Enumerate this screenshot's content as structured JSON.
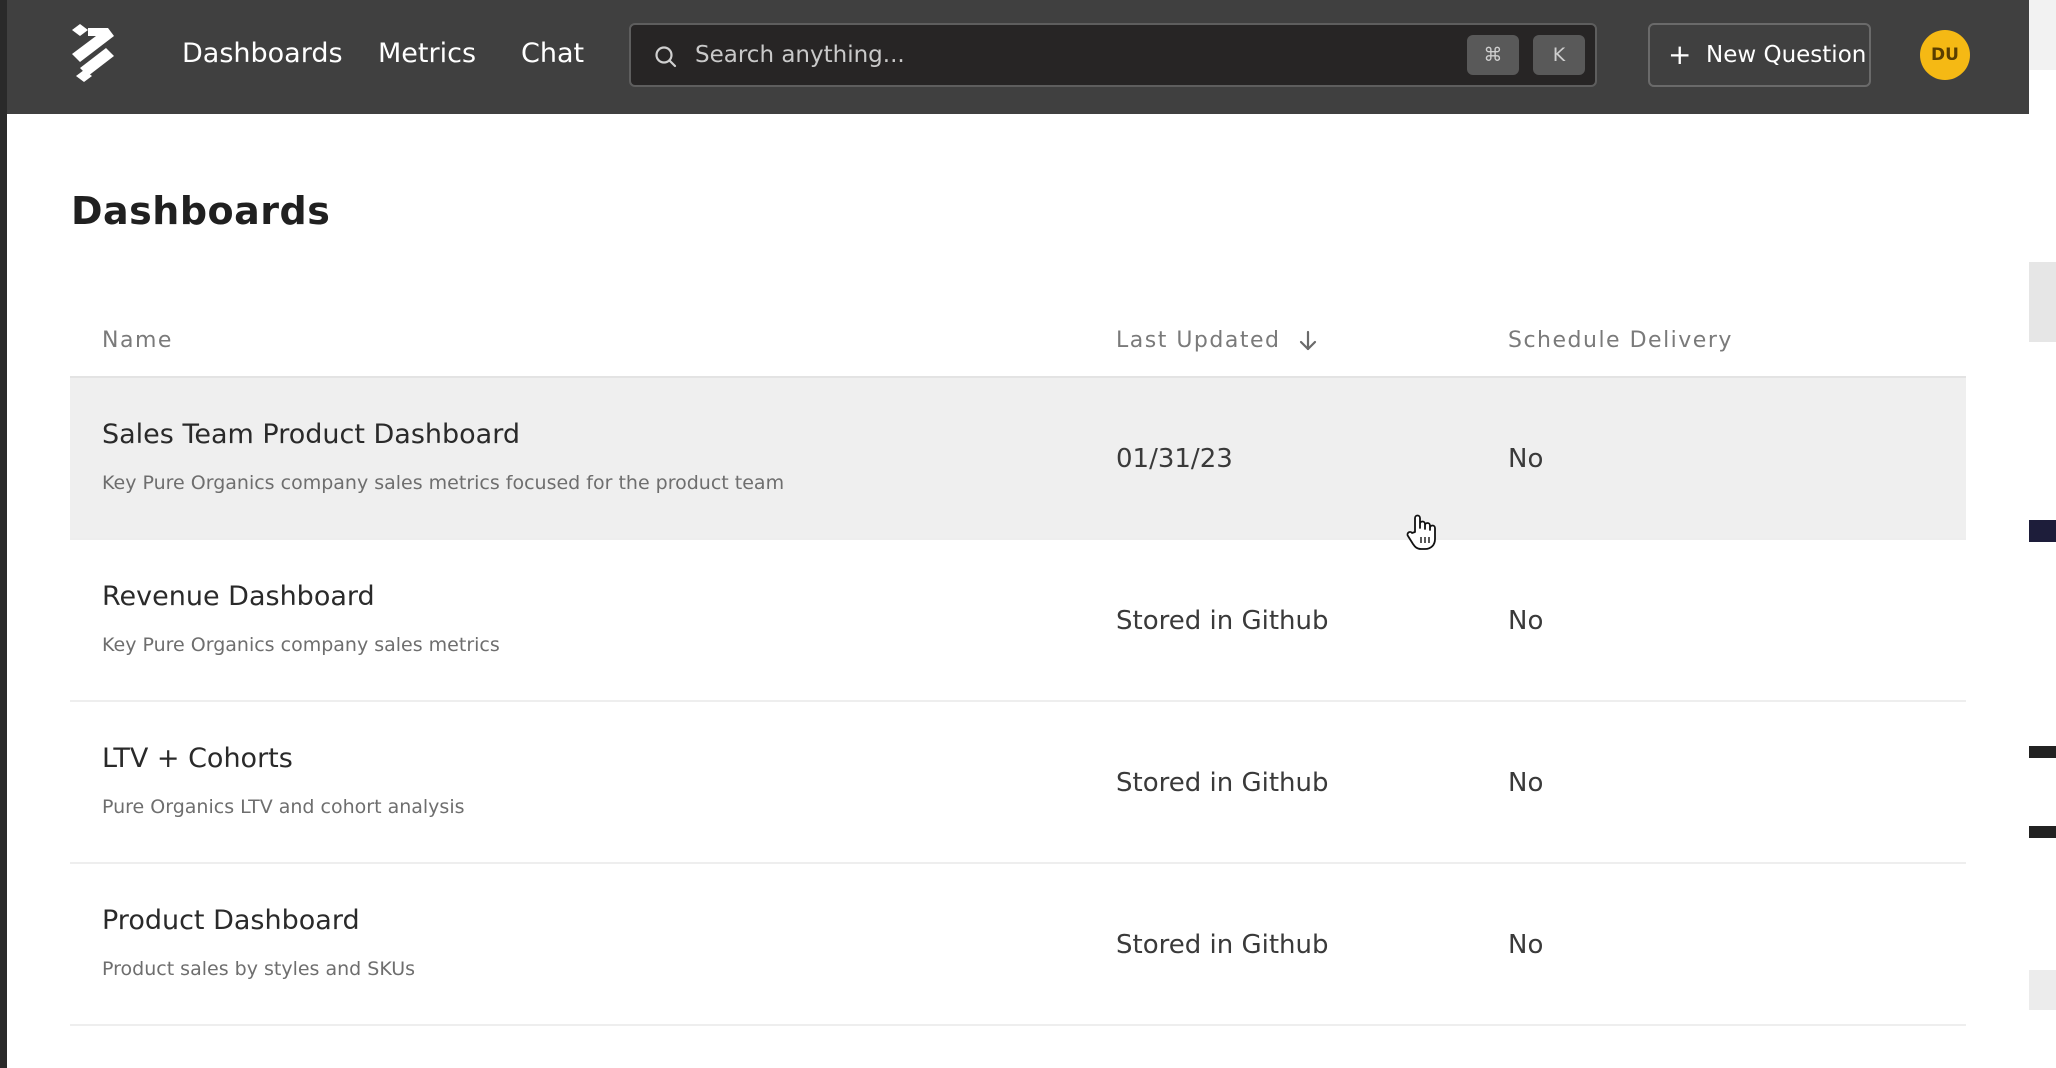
{
  "nav": {
    "links": [
      "Dashboards",
      "Metrics",
      "Chat"
    ],
    "search": {
      "placeholder": "Search anything...",
      "shortcut_keys": [
        "⌘",
        "K"
      ]
    },
    "new_question_label": "New Question",
    "avatar_initials": "DU"
  },
  "page": {
    "title": "Dashboards"
  },
  "table": {
    "columns": {
      "name": "Name",
      "last_updated": "Last Updated",
      "schedule_delivery": "Schedule Delivery"
    },
    "sort": {
      "column": "Last Updated",
      "direction": "descending"
    },
    "rows": [
      {
        "name": "Sales Team Product Dashboard",
        "description": "Key Pure Organics company sales metrics focused for the product team",
        "last_updated": "01/31/23",
        "schedule_delivery": "No"
      },
      {
        "name": "Revenue Dashboard",
        "description": "Key Pure Organics company sales metrics",
        "last_updated": "Stored in Github",
        "schedule_delivery": "No"
      },
      {
        "name": "LTV + Cohorts",
        "description": "Pure Organics LTV and cohort analysis",
        "last_updated": "Stored in Github",
        "schedule_delivery": "No"
      },
      {
        "name": "Product Dashboard",
        "description": "Product sales by styles and SKUs",
        "last_updated": "Stored in Github",
        "schedule_delivery": "No"
      }
    ]
  },
  "colors": {
    "topbar": "#404040",
    "avatar": "#f5b914",
    "row_hover": "#efefef"
  },
  "icons": [
    "logo-icon",
    "search-icon",
    "plus-icon",
    "sort-down-arrow-icon",
    "hand-cursor-icon"
  ]
}
